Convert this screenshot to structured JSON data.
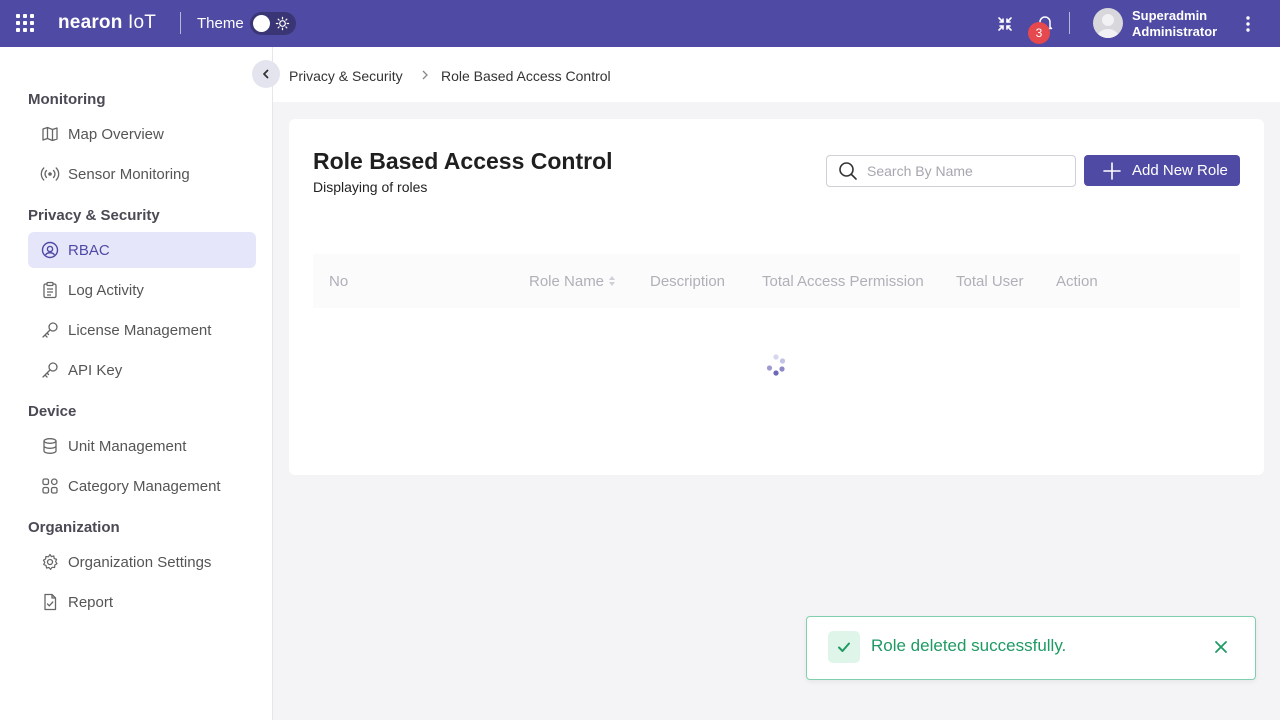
{
  "topbar": {
    "brand_main": "nearon",
    "brand_sub": "IoT",
    "theme_label": "Theme",
    "notification_count": "3",
    "user_name": "Superadmin",
    "user_role": "Administrator",
    "background": "#4f4aa3"
  },
  "breadcrumb": {
    "parent": "Privacy & Security",
    "current": "Role Based Access Control"
  },
  "sidebar": {
    "sections": [
      {
        "title": "Monitoring",
        "items": [
          {
            "label": "Map Overview",
            "icon": "map-icon"
          },
          {
            "label": "Sensor Monitoring",
            "icon": "broadcast-icon"
          }
        ]
      },
      {
        "title": "Privacy & Security",
        "items": [
          {
            "label": "RBAC",
            "icon": "user-circle-icon",
            "active": true
          },
          {
            "label": "Log Activity",
            "icon": "clipboard-icon"
          },
          {
            "label": "License Management",
            "icon": "key-icon"
          },
          {
            "label": "API Key",
            "icon": "key-icon"
          }
        ]
      },
      {
        "title": "Device",
        "items": [
          {
            "label": "Unit Management",
            "icon": "database-icon"
          },
          {
            "label": "Category Management",
            "icon": "grid-icon"
          }
        ]
      },
      {
        "title": "Organization",
        "items": [
          {
            "label": "Organization Settings",
            "icon": "gear-icon"
          },
          {
            "label": "Report",
            "icon": "report-icon"
          }
        ]
      }
    ]
  },
  "main": {
    "title": "Role Based Access Control",
    "subtitle": "Displaying of roles",
    "search_placeholder": "Search By Name",
    "add_button_label": "Add New Role",
    "columns": [
      "No",
      "Role Name",
      "Description",
      "Total Access Permission",
      "Total User",
      "Action"
    ]
  },
  "toast": {
    "message": "Role deleted successfully.",
    "accent": "#1e9a63"
  }
}
